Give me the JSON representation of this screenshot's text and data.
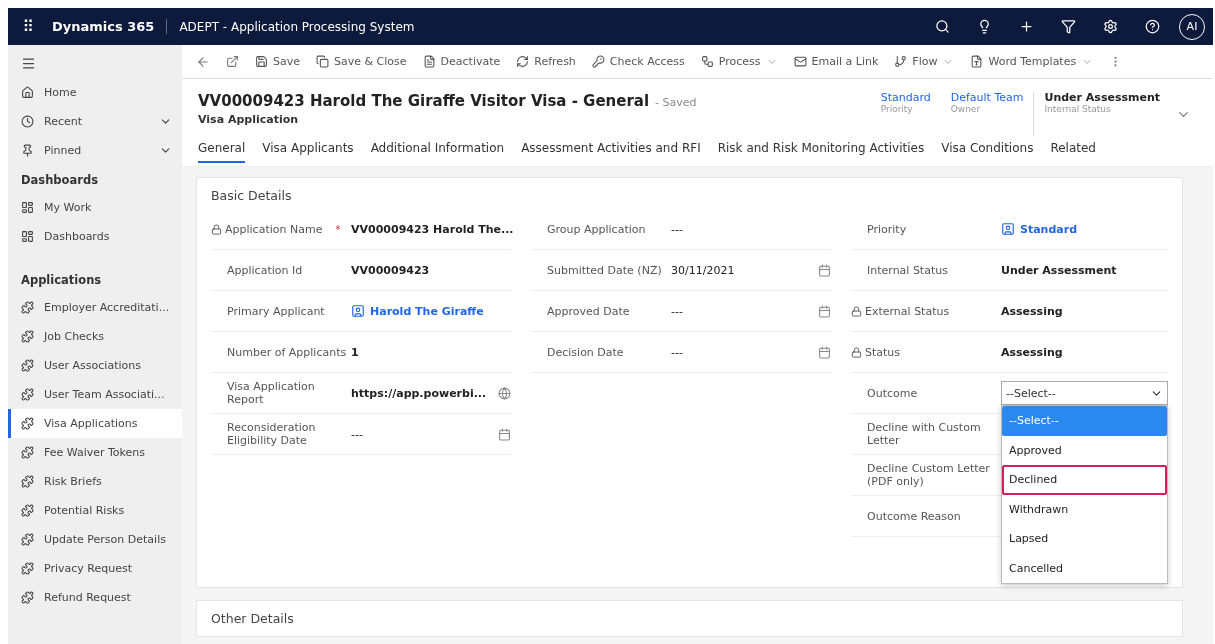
{
  "app": {
    "launcher": "⠿",
    "name": "Dynamics 365",
    "title": "ADEPT - Application Processing System",
    "avatar": "AI"
  },
  "topbar_icons": [
    {
      "kind": "search"
    },
    {
      "kind": "lightbulb"
    },
    {
      "kind": "plus"
    },
    {
      "kind": "filter"
    },
    {
      "kind": "settings"
    },
    {
      "kind": "help"
    }
  ],
  "sidebar": {
    "top_items": [
      {
        "label": "Home",
        "expandable": false
      },
      {
        "label": "Recent",
        "expandable": true
      },
      {
        "label": "Pinned",
        "expandable": true
      }
    ],
    "groups": [
      {
        "title": "Dashboards",
        "items": [
          {
            "label": "My Work",
            "selected": false
          },
          {
            "label": "Dashboards",
            "selected": false
          }
        ]
      },
      {
        "title": "Applications",
        "items": [
          {
            "label": "Employer Accreditati...",
            "selected": false
          },
          {
            "label": "Job Checks",
            "selected": false
          },
          {
            "label": "User Associations",
            "selected": false
          },
          {
            "label": "User Team Associati...",
            "selected": false
          },
          {
            "label": "Visa Applications",
            "selected": true
          },
          {
            "label": "Fee Waiver Tokens",
            "selected": false
          },
          {
            "label": "Risk Briefs",
            "selected": false
          },
          {
            "label": "Potential Risks",
            "selected": false
          },
          {
            "label": "Update Person Details",
            "selected": false
          },
          {
            "label": "Privacy Request",
            "selected": false
          },
          {
            "label": "Refund Request",
            "selected": false
          }
        ]
      }
    ]
  },
  "commands": [
    {
      "label": "Save",
      "dropdown": false
    },
    {
      "label": "Save & Close",
      "dropdown": false
    },
    {
      "label": "Deactivate",
      "dropdown": false
    },
    {
      "label": "Refresh",
      "dropdown": false
    },
    {
      "label": "Check Access",
      "dropdown": false
    },
    {
      "label": "Process",
      "dropdown": true
    },
    {
      "label": "Email a Link",
      "dropdown": false
    },
    {
      "label": "Flow",
      "dropdown": true
    },
    {
      "label": "Word Templates",
      "dropdown": true
    }
  ],
  "record": {
    "title": "VV00009423 Harold The Giraffe Visitor Visa - General",
    "saved": "- Saved",
    "entity": "Visa Application",
    "header_fields": [
      {
        "value": "Standard",
        "label": "Priority",
        "kind": "link"
      },
      {
        "value": "Default Team",
        "label": "Owner",
        "kind": "link"
      },
      {
        "value": "Under Assessment",
        "label": "Internal Status",
        "kind": "text"
      }
    ]
  },
  "tabs": [
    {
      "label": "General",
      "selected": true
    },
    {
      "label": "Visa Applicants",
      "selected": false
    },
    {
      "label": "Additional Information",
      "selected": false
    },
    {
      "label": "Assessment Activities and RFI",
      "selected": false
    },
    {
      "label": "Risk and Risk Monitoring Activities",
      "selected": false
    },
    {
      "label": "Visa Conditions",
      "selected": false
    },
    {
      "label": "Related",
      "selected": false
    }
  ],
  "section": {
    "title": "Basic Details",
    "columns": [
      [
        {
          "label": "Application Name",
          "value": "VV00009423 Harold The...",
          "kind": "text",
          "locked": true,
          "required_mark": "*"
        },
        {
          "label": "Application Id",
          "value": "VV00009423",
          "kind": "text",
          "locked": false
        },
        {
          "label": "Primary Applicant",
          "value": "Harold The Giraffe",
          "kind": "lookup",
          "locked": false
        },
        {
          "label": "Number of Applicants",
          "value": "1",
          "kind": "text",
          "locked": false
        },
        {
          "label": "Visa Application Report",
          "value": "https://app.powerbi...",
          "kind": "url",
          "locked": false
        },
        {
          "label": "Reconsideration Eligibility Date",
          "value": "---",
          "kind": "date",
          "locked": false
        }
      ],
      [
        {
          "label": "Group Application",
          "value": "---",
          "kind": "text",
          "locked": false
        },
        {
          "label": "Submitted Date (NZ)",
          "value": "30/11/2021",
          "kind": "date",
          "locked": false
        },
        {
          "label": "Approved Date",
          "value": "---",
          "kind": "date",
          "locked": false
        },
        {
          "label": "Decision Date",
          "value": "---",
          "kind": "date",
          "locked": false
        }
      ],
      [
        {
          "label": "Priority",
          "value": "Standard",
          "kind": "lookup",
          "locked": false
        },
        {
          "label": "Internal Status",
          "value": "Under Assessment",
          "kind": "text",
          "locked": false
        },
        {
          "label": "External Status",
          "value": "Assessing",
          "kind": "text",
          "locked": true
        },
        {
          "label": "Status",
          "value": "Assessing",
          "kind": "text",
          "locked": true
        },
        {
          "label": "Outcome",
          "value": "--Select--",
          "kind": "select",
          "locked": false,
          "open": true,
          "options": [
            {
              "label": "--Select--",
              "selected": true,
              "highlighted": false
            },
            {
              "label": "Approved",
              "selected": false,
              "highlighted": false
            },
            {
              "label": "Declined",
              "selected": false,
              "highlighted": true
            },
            {
              "label": "Withdrawn",
              "selected": false,
              "highlighted": false
            },
            {
              "label": "Lapsed",
              "selected": false,
              "highlighted": false
            },
            {
              "label": "Cancelled",
              "selected": false,
              "highlighted": false
            }
          ]
        },
        {
          "label": "Decline with Custom Letter",
          "kind": "empty",
          "locked": false
        },
        {
          "label": "Decline Custom Letter (PDF only)",
          "kind": "empty",
          "locked": false
        },
        {
          "label": "Outcome Reason",
          "kind": "empty",
          "locked": false
        }
      ]
    ]
  },
  "other_section": {
    "title": "Other Details"
  }
}
